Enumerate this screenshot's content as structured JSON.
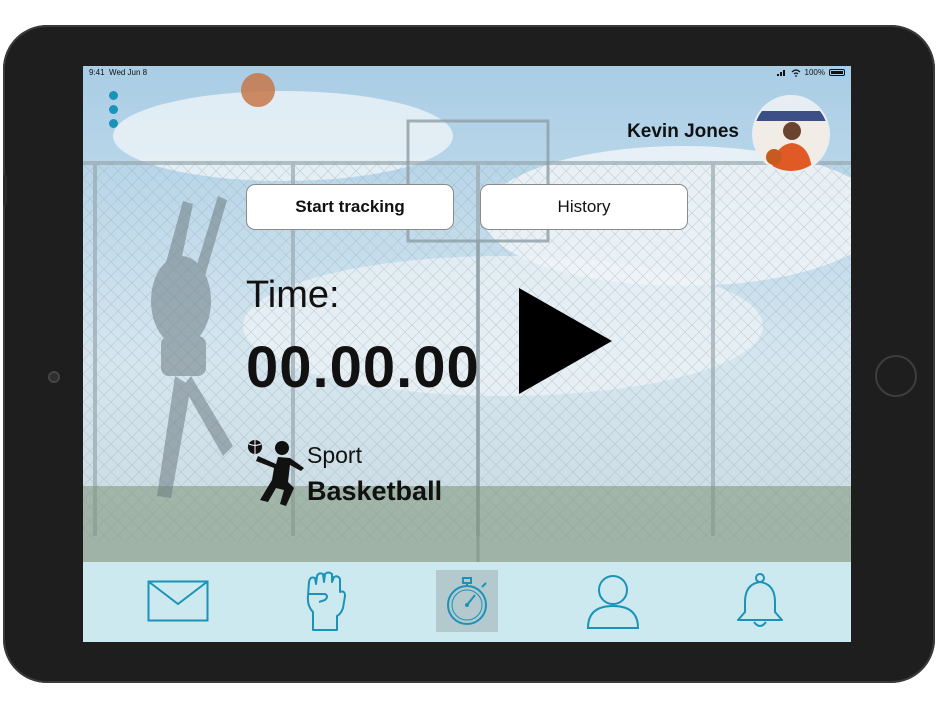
{
  "status_bar": {
    "time": "9:41",
    "date": "Wed Jun 8",
    "battery": "100%"
  },
  "user": {
    "name": "Kevin Jones",
    "avatar_icon": "user-photo"
  },
  "tabs": [
    {
      "label": "Start tracking",
      "active": true
    },
    {
      "label": "History",
      "active": false
    }
  ],
  "timer": {
    "label": "Time:",
    "value": "00.00.00",
    "control_icon": "play-icon"
  },
  "sport": {
    "label": "Sport",
    "value": "Basketball",
    "icon": "basketball-player-icon"
  },
  "bottom_nav": [
    {
      "icon": "mail-icon",
      "active": false
    },
    {
      "icon": "fist-icon",
      "active": false
    },
    {
      "icon": "stopwatch-icon",
      "active": true
    },
    {
      "icon": "profile-icon",
      "active": false
    },
    {
      "icon": "bell-icon",
      "active": false
    }
  ],
  "colors": {
    "accent": "#1b93b8",
    "nav_bg": "#cde9f0",
    "nav_active": "#b3c9ce",
    "device": "#1e1e1e"
  }
}
